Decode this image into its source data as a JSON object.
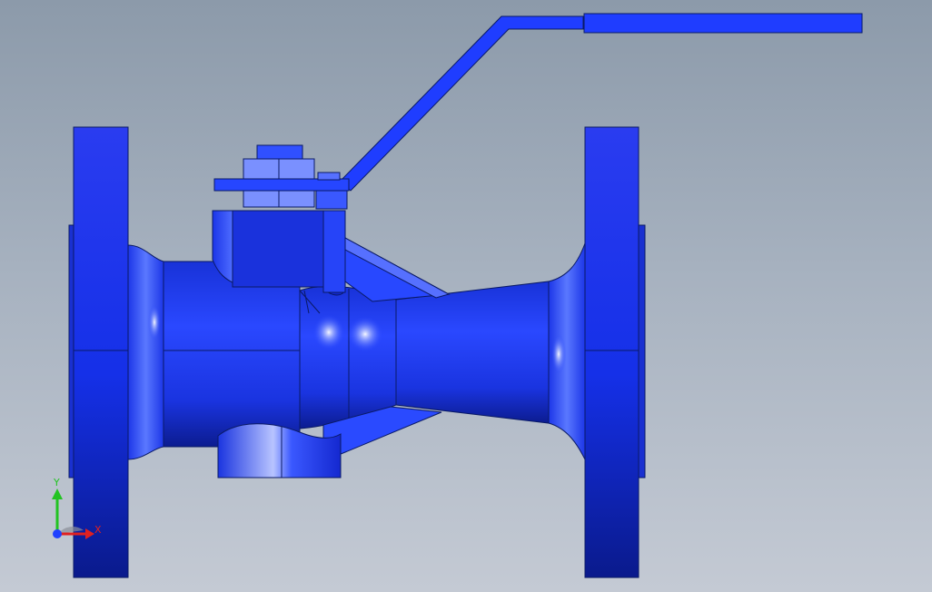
{
  "viewport": {
    "part_color": "#1a3cff",
    "part_edge_color": "#0a1a66",
    "background_top": "#8c9aaa",
    "background_bottom": "#c4cad4"
  },
  "triad": {
    "x_label": "X",
    "y_label": "Y",
    "x_color": "#e02020",
    "y_color": "#20c020",
    "z_color": "#2040ff"
  }
}
